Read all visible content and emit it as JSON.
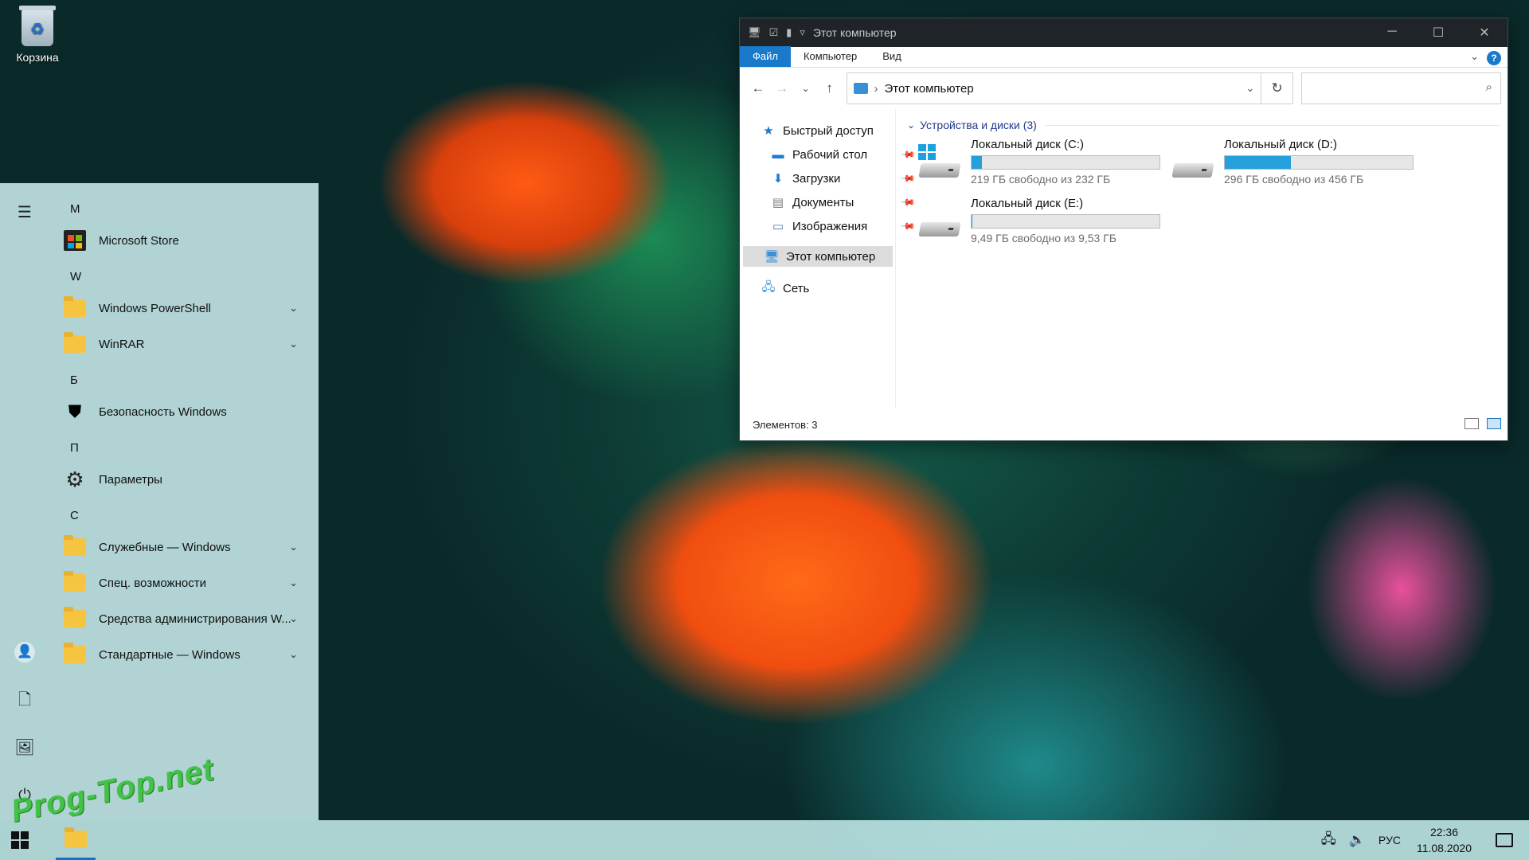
{
  "desktop": {
    "recycle_bin_label": "Корзина"
  },
  "start_menu": {
    "groups": [
      {
        "letter": "M",
        "apps": [
          {
            "label": "Microsoft Store",
            "icon": "store-icon",
            "expand": false
          }
        ]
      },
      {
        "letter": "W",
        "apps": [
          {
            "label": "Windows PowerShell",
            "icon": "folder-icon",
            "expand": true
          },
          {
            "label": "WinRAR",
            "icon": "folder-icon",
            "expand": true
          }
        ]
      },
      {
        "letter": "Б",
        "apps": [
          {
            "label": "Безопасность Windows",
            "icon": "shield-icon",
            "expand": false
          }
        ]
      },
      {
        "letter": "П",
        "apps": [
          {
            "label": "Параметры",
            "icon": "gear-icon",
            "expand": false
          }
        ]
      },
      {
        "letter": "С",
        "apps": [
          {
            "label": "Служебные — Windows",
            "icon": "folder-icon",
            "expand": true
          },
          {
            "label": "Спец. возможности",
            "icon": "folder-icon",
            "expand": true
          },
          {
            "label": "Средства администрирования W...",
            "icon": "folder-icon",
            "expand": true
          },
          {
            "label": "Стандартные — Windows",
            "icon": "folder-icon",
            "expand": true
          }
        ]
      }
    ],
    "rail_icons": [
      "hamburger-menu-icon",
      "user-icon",
      "document-icon",
      "pictures-icon",
      "power-icon"
    ]
  },
  "explorer": {
    "title": "Этот компьютер",
    "ribbon_tabs": [
      "Файл",
      "Компьютер",
      "Вид"
    ],
    "address": "Этот компьютер",
    "search_placeholder": "",
    "nav": {
      "quick_access": "Быстрый доступ",
      "desktop": "Рабочий стол",
      "downloads": "Загрузки",
      "documents": "Документы",
      "images": "Изображения",
      "this_pc": "Этот компьютер",
      "network": "Сеть"
    },
    "group_header": "Устройства и диски (3)",
    "drives": [
      {
        "name": "Локальный диск (C:)",
        "free_text": "219 ГБ свободно из 232 ГБ",
        "used_fraction": 0.056,
        "system": true
      },
      {
        "name": "Локальный диск (D:)",
        "free_text": "296 ГБ свободно из 456 ГБ",
        "used_fraction": 0.351,
        "system": false
      },
      {
        "name": "Локальный диск (E:)",
        "free_text": "9,49 ГБ свободно из 9,53 ГБ",
        "used_fraction": 0.004,
        "system": false
      }
    ],
    "status": "Элементов: 3"
  },
  "taskbar": {
    "language": "РУС",
    "time": "22:36",
    "date": "11.08.2020"
  },
  "watermark": "Prog-Top.net",
  "colors": {
    "accent": "#1979ca",
    "drive_bar": "#26a0da"
  }
}
